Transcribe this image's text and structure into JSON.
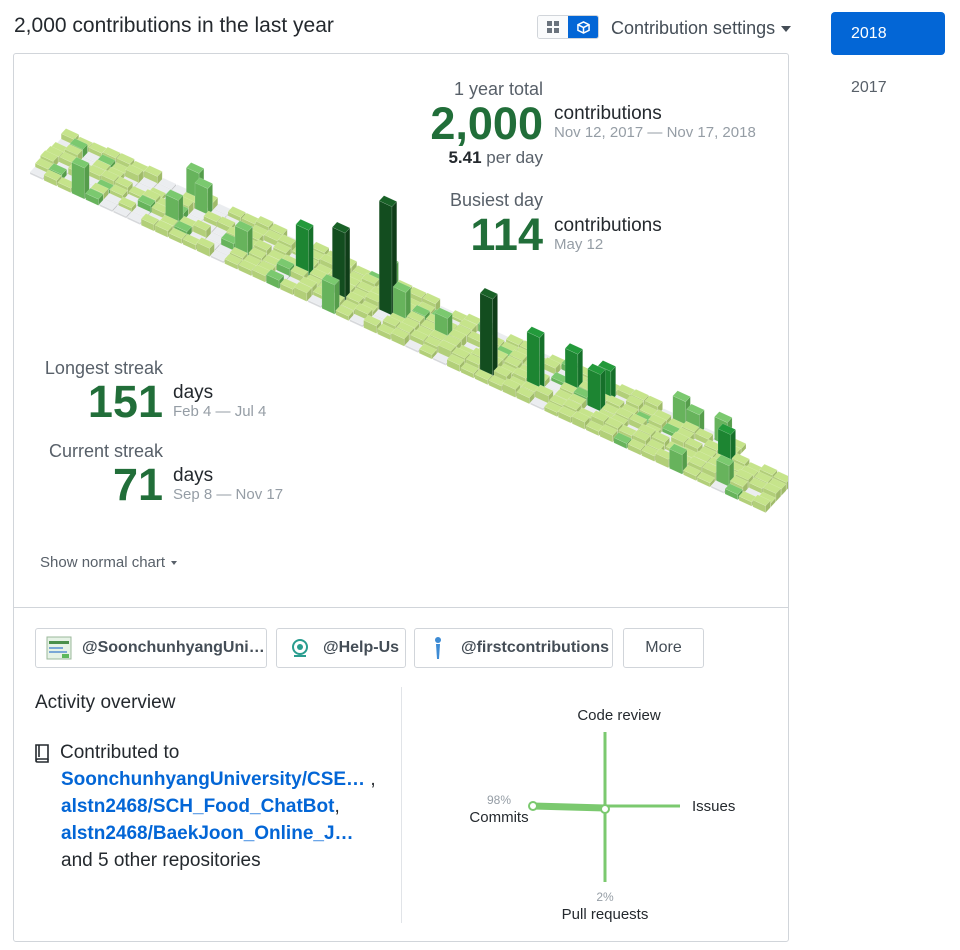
{
  "header": {
    "title": "2,000 contributions in the last year",
    "settings_label": "Contribution settings"
  },
  "year_list": [
    "2018",
    "2017"
  ],
  "stats": {
    "year_total_label": "1 year total",
    "year_total": "2,000",
    "year_total_unit": "contributions",
    "year_range": "Nov 12, 2017 — Nov 17, 2018",
    "per_day_value": "5.41",
    "per_day_label": "per day",
    "busiest_label": "Busiest day",
    "busiest_value": "114",
    "busiest_unit": "contributions",
    "busiest_date": "May 12",
    "longest_label": "Longest streak",
    "longest_value": "151",
    "longest_unit": "days",
    "longest_range": "Feb 4 — Jul 4",
    "current_label": "Current streak",
    "current_value": "71",
    "current_unit": "days",
    "current_range": "Sep 8 — Nov 17"
  },
  "show_normal": "Show normal chart",
  "orgs": [
    "@SoonchunhyangUni…",
    "@Help-Us",
    "@firstcontributions"
  ],
  "more_label": "More",
  "overview": {
    "title": "Activity overview",
    "contributed_to": "Contributed to",
    "repos": [
      "SoonchunhyangUniversity/CSE…",
      "alstn2468/SCH_Food_ChatBot",
      "alstn2468/BaekJoon_Online_J…"
    ],
    "other": "and 5 other repositories"
  },
  "activity": {
    "code_review": "Code review",
    "issues": "Issues",
    "commits": "Commits",
    "commits_pct": "98%",
    "pull_requests": "Pull requests",
    "pull_requests_pct": "2%"
  },
  "colors": {
    "accent": "#0366d6",
    "green_dark": "#216e39",
    "green_light": "#c6e48b",
    "activity_green": "#7bc96f"
  },
  "icons": [
    "grid-view-icon",
    "cube-view-icon",
    "caret-down-icon",
    "repo-book-icon"
  ]
}
